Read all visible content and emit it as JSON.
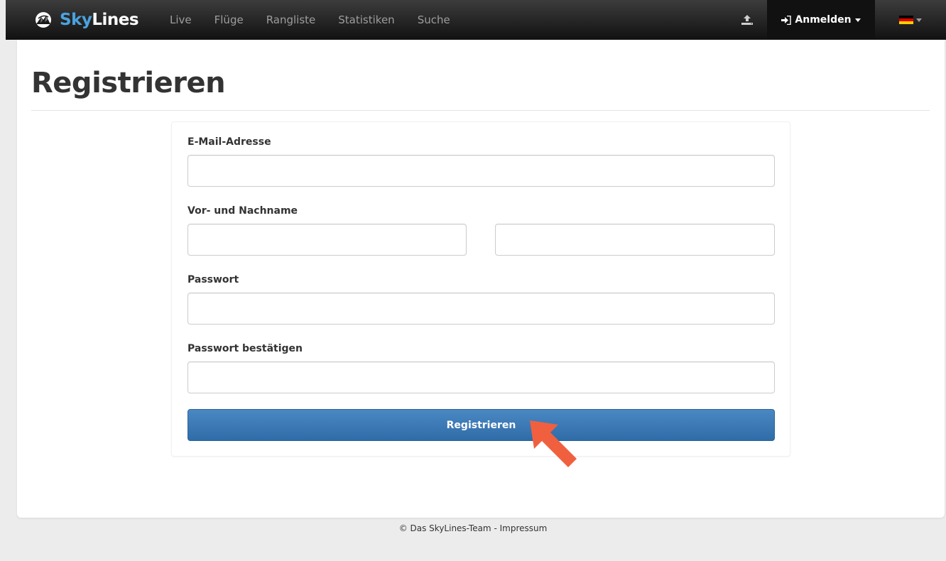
{
  "navbar": {
    "brand_sky": "Sky",
    "brand_lines": "Lines",
    "links": [
      "Live",
      "Flüge",
      "Rangliste",
      "Statistiken",
      "Suche"
    ],
    "login_label": "Anmelden",
    "upload_icon": "upload-icon",
    "language_flag": "german-flag-icon",
    "flag_colors": [
      "#000000",
      "#dd0000",
      "#ffce00"
    ]
  },
  "page": {
    "title": "Registrieren"
  },
  "form": {
    "email_label": "E-Mail-Adresse",
    "email_value": "",
    "name_label": "Vor- und Nachname",
    "first_name_value": "",
    "last_name_value": "",
    "password_label": "Passwort",
    "password_value": "",
    "password_confirm_label": "Passwort bestätigen",
    "password_confirm_value": "",
    "submit_label": "Registrieren"
  },
  "footer": {
    "copyright": "© Das SkyLines-Team",
    "separator": " - ",
    "impressum": "Impressum"
  },
  "colors": {
    "accent": "#4aa3df",
    "primary_button": "#337ab7",
    "pointer": "#f0603f"
  }
}
